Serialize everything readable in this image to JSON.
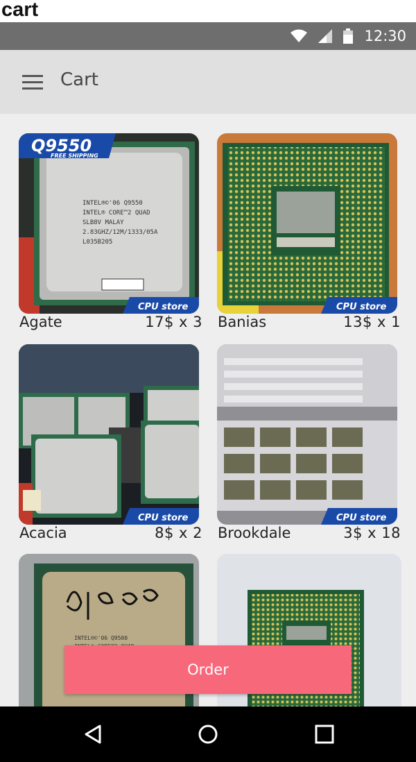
{
  "page_caption": "cart",
  "status_bar": {
    "time": "12:30",
    "icons": [
      "wifi-icon",
      "signal-icon",
      "battery-icon"
    ]
  },
  "app_bar": {
    "title": "Cart",
    "menu_icon": "menu-icon"
  },
  "products": [
    {
      "name": "Agate",
      "price_qty": "17$  x  3",
      "image_label": "Q9550"
    },
    {
      "name": "Banias",
      "price_qty": "13$  x  1"
    },
    {
      "name": "Acacia",
      "price_qty": "8$  x  2"
    },
    {
      "name": "Brookdale",
      "price_qty": "3$  x  18"
    },
    {
      "name": "",
      "price_qty": ""
    },
    {
      "name": "",
      "price_qty": ""
    }
  ],
  "order_button": {
    "label": "Order"
  },
  "nav_bar": {
    "icons": [
      "back-icon",
      "home-icon",
      "recents-icon"
    ]
  },
  "colors": {
    "status_bar": "#6e6e6e",
    "app_bar": "#e0e0e0",
    "background": "#eeeeee",
    "accent": "#f7687a"
  }
}
